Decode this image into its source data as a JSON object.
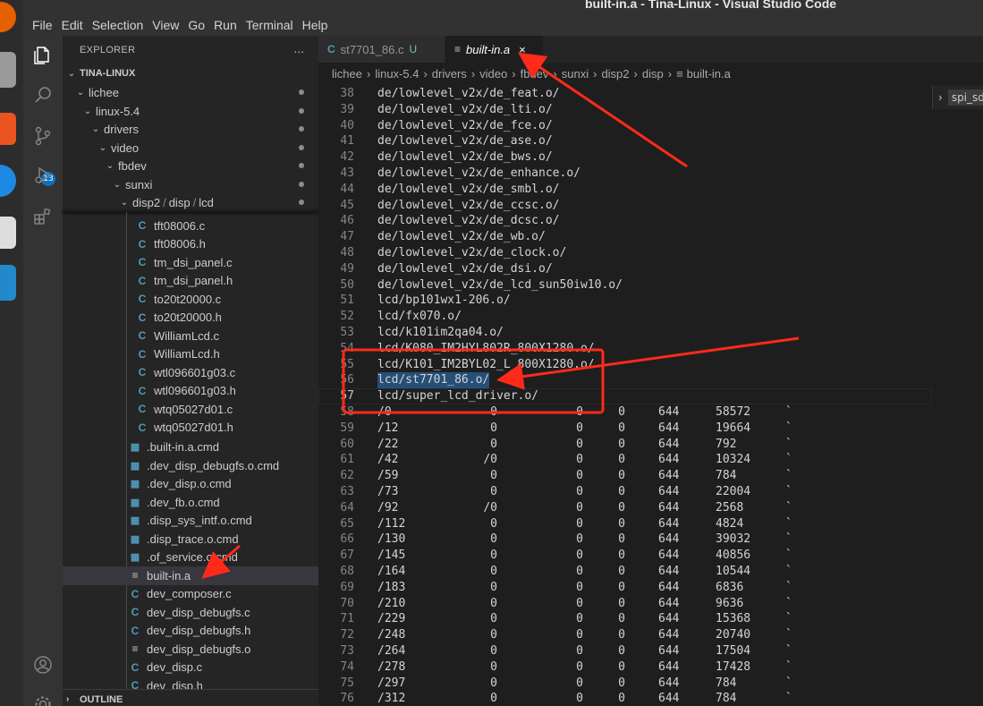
{
  "window": {
    "title": "built-in.a - Tina-Linux - Visual Studio Code"
  },
  "menu": [
    "File",
    "Edit",
    "Selection",
    "View",
    "Go",
    "Run",
    "Terminal",
    "Help"
  ],
  "activity_bar": {
    "scm_badge": "13"
  },
  "explorer": {
    "title": "EXPLORER",
    "more": "...",
    "root": "TINA-LINUX",
    "folders": [
      "lichee",
      "linux-5.4",
      "drivers",
      "video",
      "fbdev",
      "sunxi"
    ],
    "compact_folder": [
      "disp2",
      "disp",
      "lcd"
    ],
    "files": [
      {
        "name": "tft08006.c",
        "type": "c"
      },
      {
        "name": "tft08006.h",
        "type": "c"
      },
      {
        "name": "tm_dsi_panel.c",
        "type": "c"
      },
      {
        "name": "tm_dsi_panel.h",
        "type": "c"
      },
      {
        "name": "to20t20000.c",
        "type": "c"
      },
      {
        "name": "to20t20000.h",
        "type": "c"
      },
      {
        "name": "WilliamLcd.c",
        "type": "c"
      },
      {
        "name": "WilliamLcd.h",
        "type": "c"
      },
      {
        "name": "wtl096601g03.c",
        "type": "c"
      },
      {
        "name": "wtl096601g03.h",
        "type": "c"
      },
      {
        "name": "wtq05027d01.c",
        "type": "c"
      },
      {
        "name": "wtq05027d01.h",
        "type": "c"
      }
    ],
    "disp_files": [
      {
        "name": ".built-in.a.cmd",
        "type": "cmd"
      },
      {
        "name": ".dev_disp_debugfs.o.cmd",
        "type": "cmd"
      },
      {
        "name": ".dev_disp.o.cmd",
        "type": "cmd"
      },
      {
        "name": ".dev_fb.o.cmd",
        "type": "cmd"
      },
      {
        "name": ".disp_sys_intf.o.cmd",
        "type": "cmd"
      },
      {
        "name": ".disp_trace.o.cmd",
        "type": "cmd"
      },
      {
        "name": ".of_service.o.cmd",
        "type": "cmd"
      },
      {
        "name": "built-in.a",
        "type": "txt"
      },
      {
        "name": "dev_composer.c",
        "type": "c"
      },
      {
        "name": "dev_disp_debugfs.c",
        "type": "c"
      },
      {
        "name": "dev_disp_debugfs.h",
        "type": "c"
      },
      {
        "name": "dev_disp_debugfs.o",
        "type": "txt"
      },
      {
        "name": "dev_disp.c",
        "type": "c"
      },
      {
        "name": "dev_disp.h",
        "type": "c"
      }
    ],
    "outline": "OUTLINE"
  },
  "tabs": [
    {
      "name": "st7701_86.c",
      "modified": "U",
      "active": false
    },
    {
      "name": "built-in.a",
      "modified": "",
      "active": true
    }
  ],
  "breadcrumb": [
    "lichee",
    "linux-5.4",
    "drivers",
    "video",
    "fbdev",
    "sunxi",
    "disp2",
    "disp",
    "built-in.a"
  ],
  "side_panel": {
    "label": "spi_sd"
  },
  "code_lines": [
    {
      "n": "38",
      "t": "de/lowlevel_v2x/de_feat.o/"
    },
    {
      "n": "39",
      "t": "de/lowlevel_v2x/de_lti.o/"
    },
    {
      "n": "40",
      "t": "de/lowlevel_v2x/de_fce.o/"
    },
    {
      "n": "41",
      "t": "de/lowlevel_v2x/de_ase.o/"
    },
    {
      "n": "42",
      "t": "de/lowlevel_v2x/de_bws.o/"
    },
    {
      "n": "43",
      "t": "de/lowlevel_v2x/de_enhance.o/"
    },
    {
      "n": "44",
      "t": "de/lowlevel_v2x/de_smbl.o/"
    },
    {
      "n": "45",
      "t": "de/lowlevel_v2x/de_ccsc.o/"
    },
    {
      "n": "46",
      "t": "de/lowlevel_v2x/de_dcsc.o/"
    },
    {
      "n": "47",
      "t": "de/lowlevel_v2x/de_wb.o/"
    },
    {
      "n": "48",
      "t": "de/lowlevel_v2x/de_clock.o/"
    },
    {
      "n": "49",
      "t": "de/lowlevel_v2x/de_dsi.o/"
    },
    {
      "n": "50",
      "t": "de/lowlevel_v2x/de_lcd_sun50iw10.o/"
    },
    {
      "n": "51",
      "t": "lcd/bp101wx1-206.o/"
    },
    {
      "n": "52",
      "t": "lcd/fx070.o/"
    },
    {
      "n": "53",
      "t": "lcd/k101im2qa04.o/"
    },
    {
      "n": "54",
      "t": "lcd/K080_IM2HYL802R_800X1280.o/"
    },
    {
      "n": "55",
      "t": "lcd/K101_IM2BYL02_L_800X1280.o/"
    },
    {
      "n": "56",
      "t": "lcd/st7701_86.o/",
      "selected": true
    },
    {
      "n": "57",
      "t": "lcd/super_lcd_driver.o/",
      "current": true
    }
  ],
  "archive_rows": [
    {
      "n": "58",
      "name": "/0",
      "a": "0",
      "b": "0",
      "c": "0",
      "mode": "644",
      "size": "58572"
    },
    {
      "n": "59",
      "name": "/12",
      "a": "0",
      "b": "0",
      "c": "0",
      "mode": "644",
      "size": "19664"
    },
    {
      "n": "60",
      "name": "/22",
      "a": "0",
      "b": "0",
      "c": "0",
      "mode": "644",
      "size": "792"
    },
    {
      "n": "61",
      "name": "/42",
      "a": "/0",
      "b": "0",
      "c": "0",
      "mode": "644",
      "size": "10324"
    },
    {
      "n": "62",
      "name": "/59",
      "a": "0",
      "b": "0",
      "c": "0",
      "mode": "644",
      "size": "784"
    },
    {
      "n": "63",
      "name": "/73",
      "a": "0",
      "b": "0",
      "c": "0",
      "mode": "644",
      "size": "22004"
    },
    {
      "n": "64",
      "name": "/92",
      "a": "/0",
      "b": "0",
      "c": "0",
      "mode": "644",
      "size": "2568"
    },
    {
      "n": "65",
      "name": "/112",
      "a": "0",
      "b": "0",
      "c": "0",
      "mode": "644",
      "size": "4824"
    },
    {
      "n": "66",
      "name": "/130",
      "a": "0",
      "b": "0",
      "c": "0",
      "mode": "644",
      "size": "39032"
    },
    {
      "n": "67",
      "name": "/145",
      "a": "0",
      "b": "0",
      "c": "0",
      "mode": "644",
      "size": "40856"
    },
    {
      "n": "68",
      "name": "/164",
      "a": "0",
      "b": "0",
      "c": "0",
      "mode": "644",
      "size": "10544"
    },
    {
      "n": "69",
      "name": "/183",
      "a": "0",
      "b": "0",
      "c": "0",
      "mode": "644",
      "size": "6836"
    },
    {
      "n": "70",
      "name": "/210",
      "a": "0",
      "b": "0",
      "c": "0",
      "mode": "644",
      "size": "9636"
    },
    {
      "n": "71",
      "name": "/229",
      "a": "0",
      "b": "0",
      "c": "0",
      "mode": "644",
      "size": "15368"
    },
    {
      "n": "72",
      "name": "/248",
      "a": "0",
      "b": "0",
      "c": "0",
      "mode": "644",
      "size": "20740"
    },
    {
      "n": "73",
      "name": "/264",
      "a": "0",
      "b": "0",
      "c": "0",
      "mode": "644",
      "size": "17504"
    },
    {
      "n": "74",
      "name": "/278",
      "a": "0",
      "b": "0",
      "c": "0",
      "mode": "644",
      "size": "17428"
    },
    {
      "n": "75",
      "name": "/297",
      "a": "0",
      "b": "0",
      "c": "0",
      "mode": "644",
      "size": "784"
    },
    {
      "n": "76",
      "name": "/312",
      "a": "0",
      "b": "0",
      "c": "0",
      "mode": "644",
      "size": "784"
    }
  ],
  "backtick": "`",
  "colors": {
    "annotation": "#ff2a1a",
    "selection": "#264f78",
    "c_icon": "#519aba"
  }
}
